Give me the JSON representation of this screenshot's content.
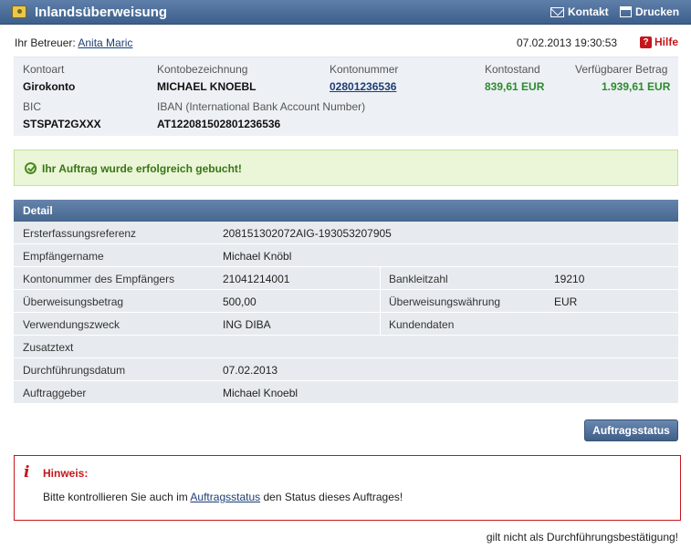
{
  "titlebar": {
    "title": "Inlandsüberweisung",
    "contact_label": "Kontakt",
    "print_label": "Drucken",
    "icons": {
      "title": "wallet-icon",
      "contact": "envelope-icon",
      "print": "printer-icon"
    }
  },
  "advisor": {
    "label": "Ihr Betreuer:",
    "name": "Anita Maric",
    "datetime": "07.02.2013 19:30:53",
    "help_label": "Hilfe"
  },
  "account": {
    "labels": {
      "type": "Kontoart",
      "name": "Kontobezeichnung",
      "number": "Kontonummer",
      "balance": "Kontostand",
      "available": "Verfügbarer Betrag",
      "bic": "BIC",
      "iban": "IBAN (International Bank Account Number)"
    },
    "values": {
      "type": "Girokonto",
      "name": "MICHAEL KNOEBL",
      "number": "02801236536",
      "balance": "839,61 EUR",
      "available": "1.939,61 EUR",
      "bic": "STSPAT2GXXX",
      "iban": "AT122081502801236536"
    },
    "positive_color": "#2c8a2c"
  },
  "success": {
    "message": "Ihr Auftrag wurde erfolgreich gebucht!"
  },
  "detail": {
    "heading": "Detail",
    "rows": [
      {
        "label": "Ersterfassungsreferenz",
        "value": "208151302072AIG-193053207905"
      },
      {
        "label": "Empfängername",
        "value": "Michael Knöbl"
      },
      {
        "label": "Kontonummer des Empfängers",
        "value": "21041214001",
        "label2": "Bankleitzahl",
        "value2": "19210"
      },
      {
        "label": "Überweisungsbetrag",
        "value": "500,00",
        "label2": "Überweisungswährung",
        "value2": "EUR"
      },
      {
        "label": "Verwendungszweck",
        "value": "ING DIBA",
        "label2": "Kundendaten",
        "value2": ""
      },
      {
        "label": "Zusatztext",
        "value": ""
      },
      {
        "label": "Durchführungsdatum",
        "value": "07.02.2013"
      },
      {
        "label": "Auftraggeber",
        "value": "Michael Knoebl"
      }
    ]
  },
  "status_button": "Auftragsstatus",
  "hint": {
    "title": "Hinweis:",
    "text_before": "Bitte kontrollieren Sie auch im ",
    "link": "Auftragsstatus",
    "text_after": " den Status dieses Auftrages!"
  },
  "footer_note": "gilt nicht als Durchführungsbestätigung!",
  "colors": {
    "accent": "#46678f",
    "error": "#c4161c",
    "success_bg": "#eaf6d7"
  }
}
